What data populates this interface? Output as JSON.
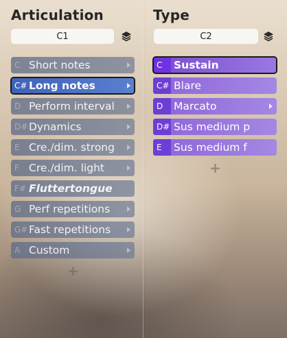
{
  "articulation": {
    "title": "Articulation",
    "selector": "C1",
    "items": [
      {
        "note": "C",
        "label": "Short notes",
        "arrow": true
      },
      {
        "note": "C#",
        "label": "Long notes",
        "arrow": true,
        "active": true
      },
      {
        "note": "D",
        "label": "Perform interval",
        "arrow": true
      },
      {
        "note": "D#",
        "label": "Dynamics",
        "arrow": true
      },
      {
        "note": "E",
        "label": "Cre./dim. strong",
        "arrow": true
      },
      {
        "note": "F",
        "label": "Cre./dim. light",
        "arrow": true
      },
      {
        "note": "F#",
        "label": "Fluttertongue",
        "arrow": false,
        "italic": true
      },
      {
        "note": "G",
        "label": "Perf repetitions",
        "arrow": true
      },
      {
        "note": "G#",
        "label": "Fast repetitions",
        "arrow": true
      },
      {
        "note": "A",
        "label": "Custom",
        "arrow": true
      }
    ],
    "add_label": "+"
  },
  "type": {
    "title": "Type",
    "selector": "C2",
    "items": [
      {
        "note": "C",
        "label": "Sustain",
        "arrow": false,
        "active": true
      },
      {
        "note": "C#",
        "label": "Blare",
        "arrow": false
      },
      {
        "note": "D",
        "label": "Marcato",
        "arrow": true
      },
      {
        "note": "D#",
        "label": "Sus medium p",
        "arrow": false
      },
      {
        "note": "E",
        "label": "Sus medium f",
        "arrow": false
      }
    ],
    "add_label": "+"
  },
  "colors": {
    "articulation_item": "#66718a",
    "articulation_active": "#4a6cc4",
    "type_item": "#9670dc",
    "type_note": "#6f32e0"
  }
}
